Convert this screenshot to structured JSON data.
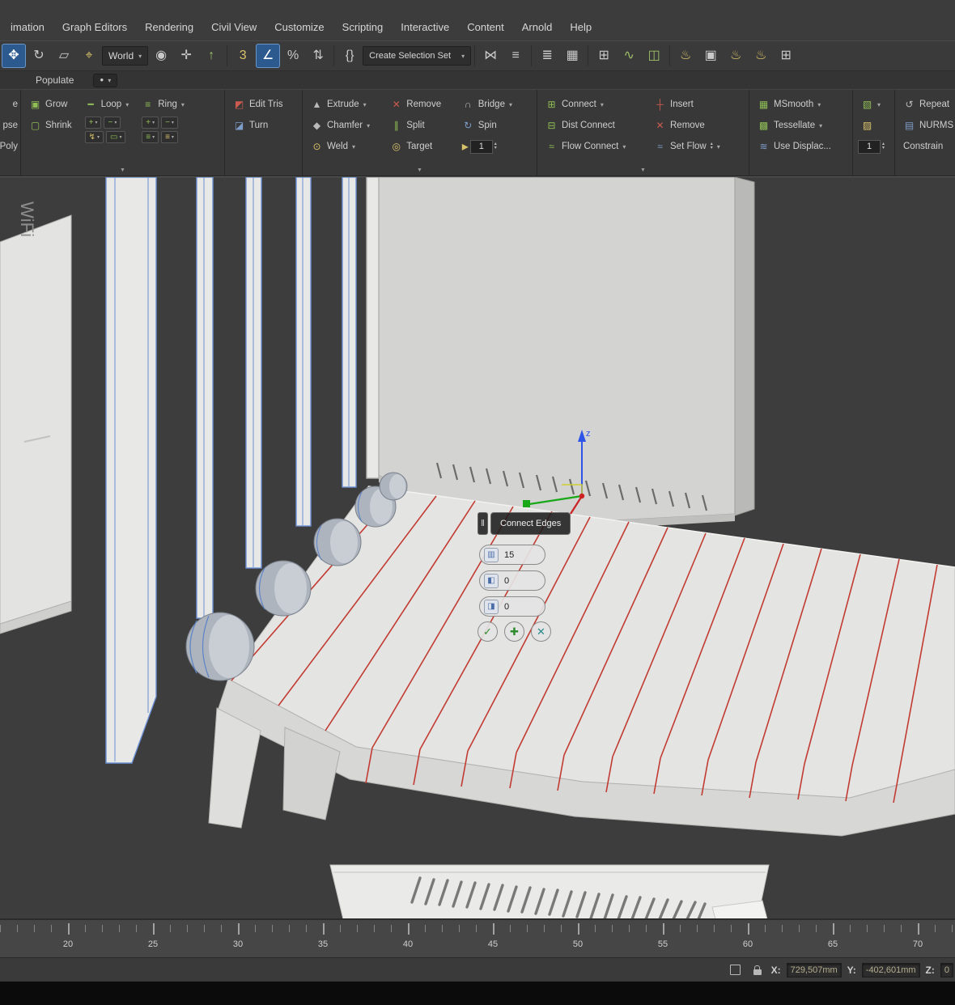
{
  "menu": {
    "items": [
      "imation",
      "Graph Editors",
      "Rendering",
      "Civil View",
      "Customize",
      "Scripting",
      "Interactive",
      "Content",
      "Arnold",
      "Help"
    ]
  },
  "ui": {
    "caret": "▾",
    "panel_arrow": "▼",
    "up": "▴",
    "down": "▾",
    "check": "✓",
    "plus": "✚",
    "cross": "✕",
    "handle": "‖",
    "dot": "●"
  },
  "toolbar": {
    "world_label": "World",
    "selection_set_label": "Create Selection Set",
    "icons": {
      "move": "✥",
      "rotate": "↻",
      "scale": "▱",
      "pivot": "⌖",
      "axis": "✛",
      "up": "↑",
      "snap3": "3",
      "angle": "∠",
      "percent": "%",
      "spin": "⇅",
      "braces": "{}",
      "mirror": "⋈",
      "align": "≡",
      "layers": "≣",
      "grid": "▦",
      "curve": "∿",
      "schematic": "◫",
      "material": "◉",
      "teapot1": "♨",
      "frame": "▣",
      "teapot2": "♨",
      "teapot3": "♨",
      "grid4": "⊞"
    }
  },
  "ribbon_tab": {
    "populate": "Populate"
  },
  "ribbon": {
    "partials": [
      "e",
      "pse",
      "Poly"
    ],
    "grow": "Grow",
    "shrink": "Shrink",
    "loop": "Loop",
    "ring": "Ring",
    "edit_tris": "Edit Tris",
    "turn": "Turn",
    "extrude": "Extrude",
    "chamfer": "Chamfer",
    "weld": "Weld",
    "remove": "Remove",
    "split": "Split",
    "target": "Target",
    "target_value": "1",
    "bridge": "Bridge",
    "spin": "Spin",
    "connect": "Connect",
    "dist_connect": "Dist Connect",
    "flow_connect": "Flow Connect",
    "insert": "Insert",
    "remove2": "Remove",
    "set_flow": "Set  Flow",
    "msmooth": "MSmooth",
    "tessellate": "Tessellate",
    "use_displace": "Use Displac...",
    "nurms_value": "1",
    "repeat": "Repeat",
    "nurms": "NURMS",
    "constrain": "Constrain"
  },
  "ribbon_icons": {
    "grow": "▣",
    "shrink": "▢",
    "loop": "━",
    "ring": "≡",
    "plus": "+",
    "minus": "−",
    "bolt": "↯",
    "bar": "▭",
    "edit_tris": "◩",
    "turn": "◪",
    "extrude": "▲",
    "chamfer": "◆",
    "weld": "⊙",
    "remove": "✕",
    "split": "∥",
    "target": "◎",
    "bridge": "∩",
    "spin": "↻",
    "connect": "⊞",
    "dist_connect": "⊟",
    "flow_connect": "≈",
    "insert": "┼",
    "set_flow": "≈",
    "msmooth": "▦",
    "tessellate": "▩",
    "displace": "≋",
    "leaf1": "▧",
    "leaf2": "▨",
    "repeat": "↺",
    "nurms": "▤",
    "spinner": "▸",
    "seg": "▥",
    "pinch": "◧",
    "slide": "◨"
  },
  "viewport": {
    "wifi_text": "WiFi",
    "z_axis_label": "z"
  },
  "caddy": {
    "title": "Connect Edges",
    "segments": "15",
    "pinch": "0",
    "slide": "0"
  },
  "timeline": {
    "labels": [
      "20",
      "25",
      "30",
      "35",
      "40",
      "45",
      "50",
      "55",
      "60",
      "65",
      "70"
    ]
  },
  "status": {
    "x_label": "X:",
    "x_value": "729,507mm",
    "y_label": "Y:",
    "y_value": "-402,601mm",
    "z_label": "Z:",
    "z_value": "0"
  }
}
